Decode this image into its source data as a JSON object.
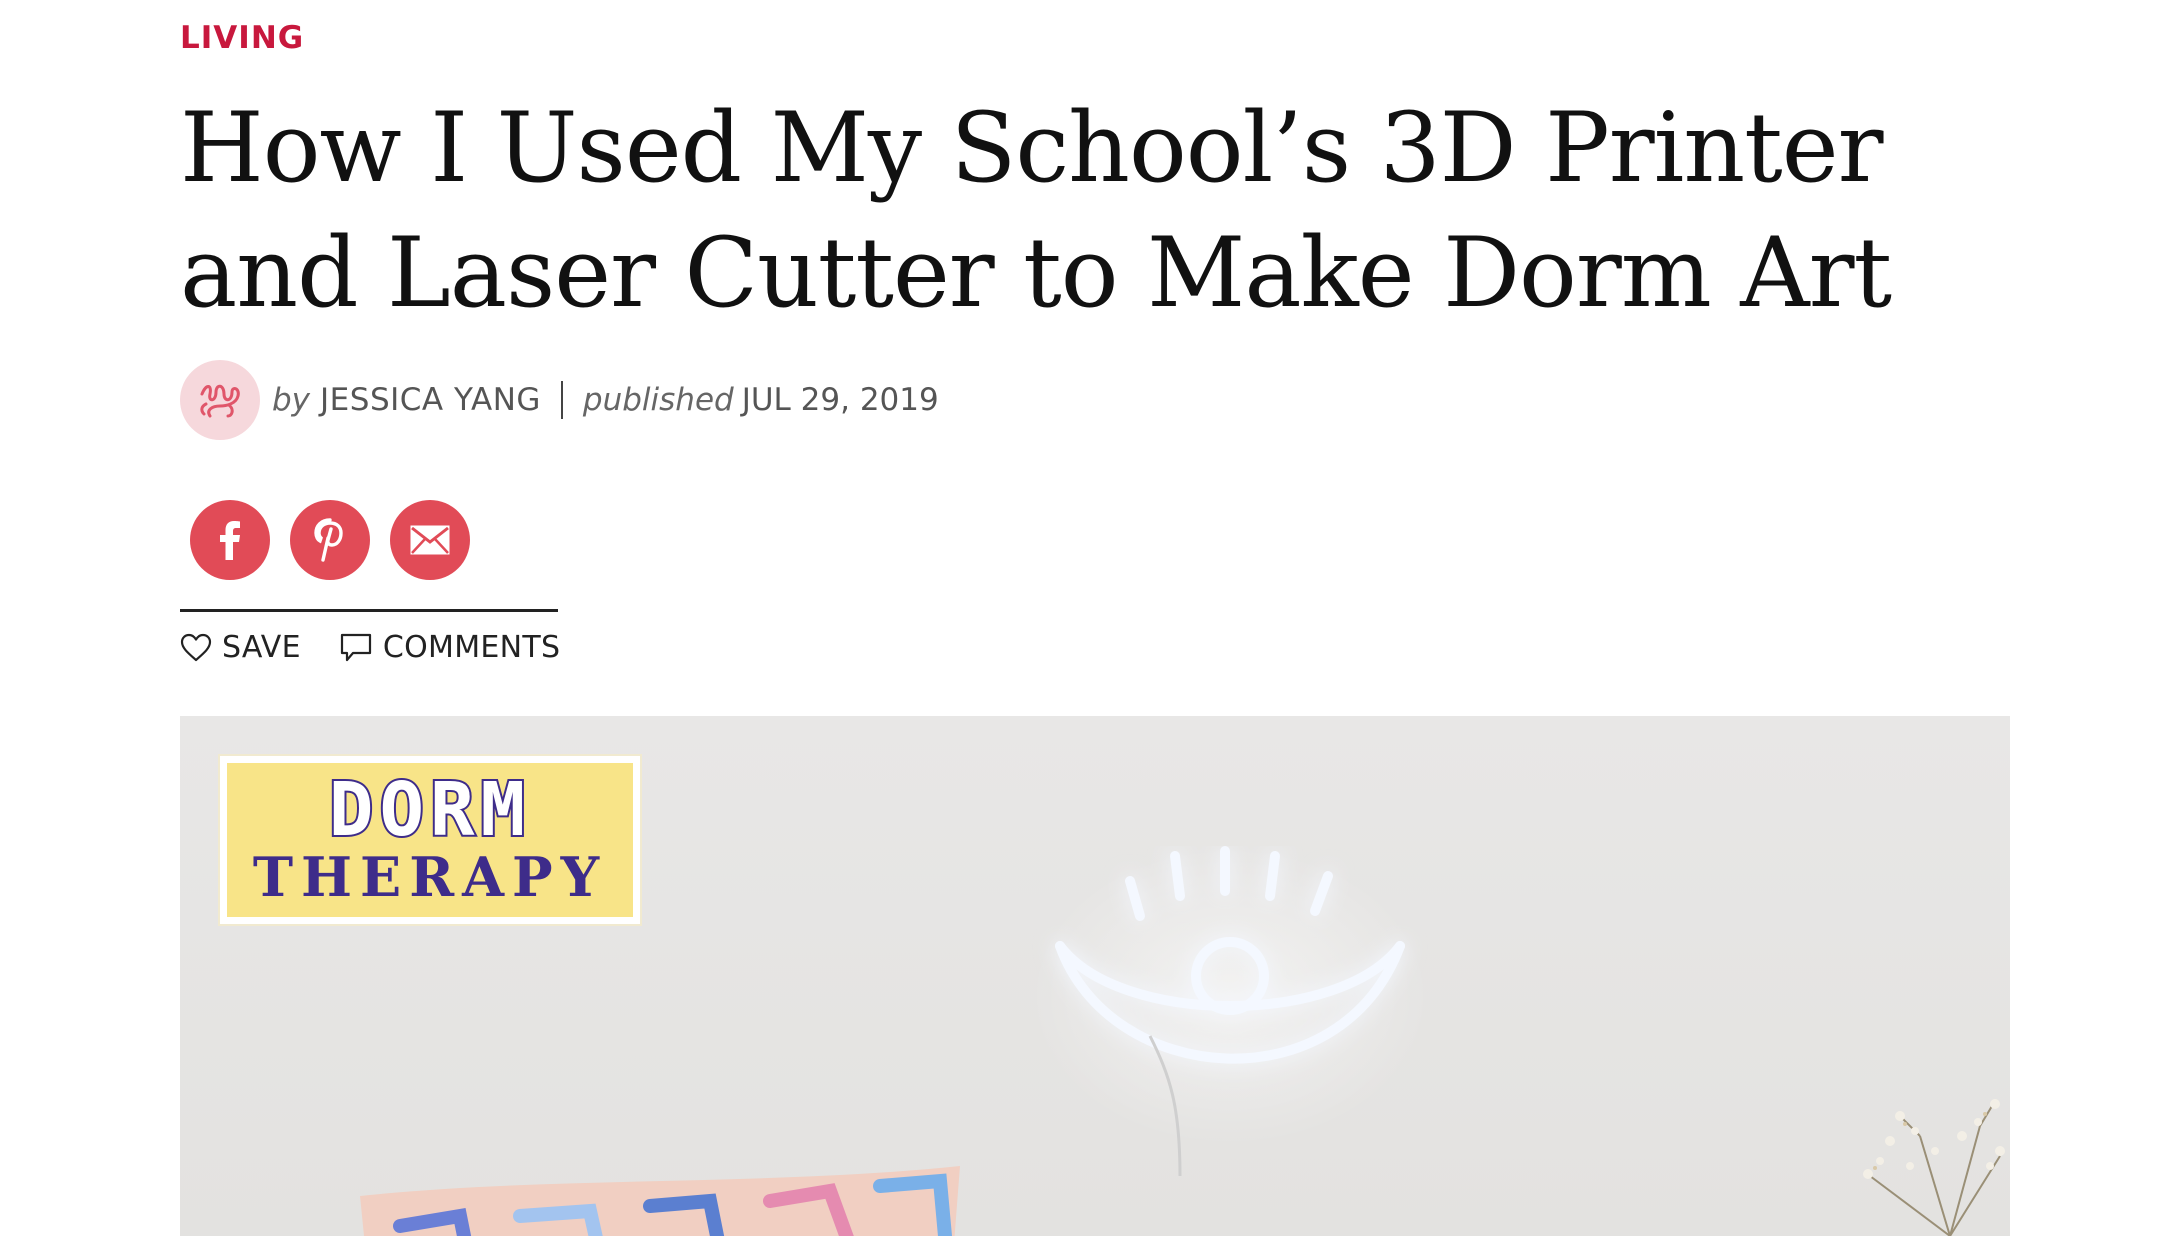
{
  "article": {
    "category": "LIVING",
    "title": "How I Used My School’s 3D Printer and Laser Cutter to Make Dorm Art",
    "byline": {
      "by_prefix": "by",
      "author": "JESSICA YANG",
      "published_prefix": "published",
      "date": "JUL 29, 2019"
    }
  },
  "share": {
    "facebook_icon": "facebook-icon",
    "pinterest_icon": "pinterest-icon",
    "email_icon": "email-icon",
    "button_color": "#e14b57"
  },
  "actions": {
    "save_label": "SAVE",
    "comments_label": "COMMENTS"
  },
  "hero": {
    "badge_line1": "DORM",
    "badge_line2": "THERAPY"
  },
  "colors": {
    "accent": "#c8183d",
    "avatar_bg": "#f6d8dc",
    "badge_yellow": "#f8e488",
    "badge_purple": "#3e2c8a"
  }
}
